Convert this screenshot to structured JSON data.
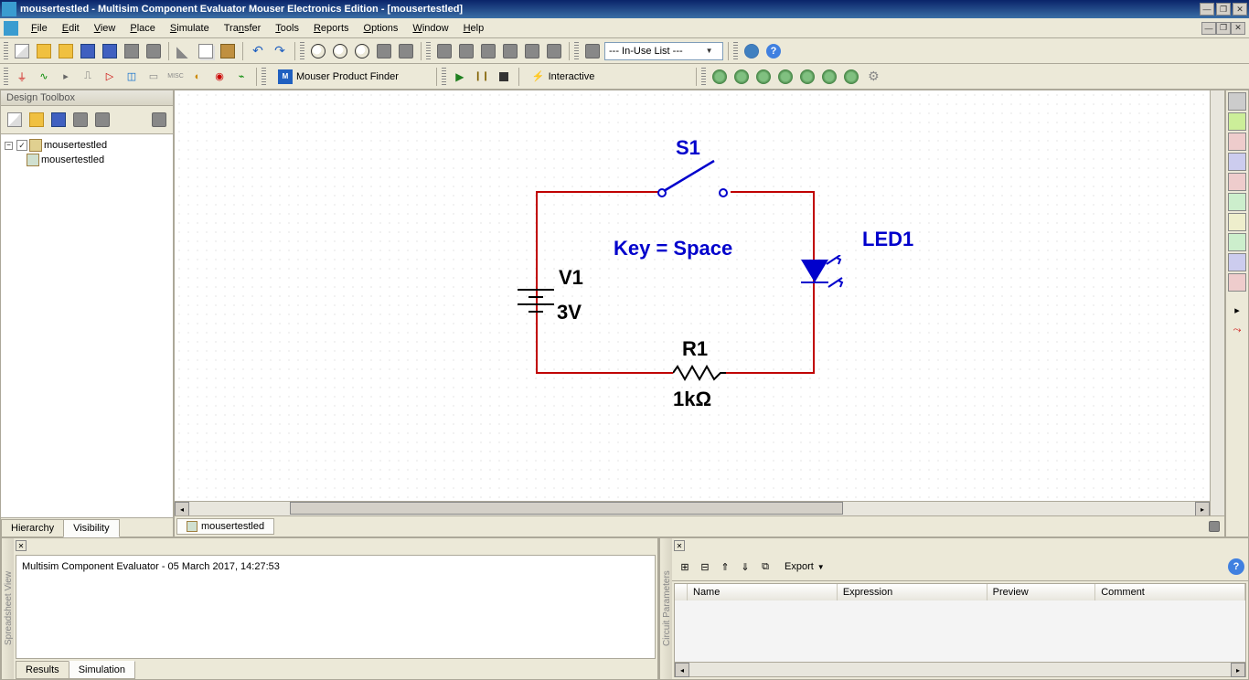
{
  "titlebar": {
    "title": "mousertestled - Multisim Component Evaluator Mouser Electronics Edition - [mousertestled]"
  },
  "menubar": {
    "items": [
      "File",
      "Edit",
      "View",
      "Place",
      "Simulate",
      "Transfer",
      "Tools",
      "Reports",
      "Options",
      "Window",
      "Help"
    ]
  },
  "toolbar2": {
    "product_finder": "Mouser Product Finder",
    "interactive": "Interactive",
    "in_use": "--- In-Use List ---"
  },
  "toolbox": {
    "title": "Design Toolbox",
    "root": "mousertestled",
    "child": "mousertestled",
    "tabs": [
      "Hierarchy",
      "Visibility"
    ]
  },
  "canvas": {
    "doc_tab": "mousertestled",
    "components": {
      "s1": "S1",
      "key": "Key = Space",
      "v1_name": "V1",
      "v1_val": "3V",
      "r1_name": "R1",
      "r1_val": "1kΩ",
      "led1": "LED1"
    }
  },
  "spreadsheet": {
    "side_label": "Spreadsheet View",
    "status": "Multisim Component Evaluator  -  05 March 2017, 14:27:53",
    "tabs": [
      "Results",
      "Simulation"
    ]
  },
  "circuit_params": {
    "side_label": "Circuit Parameters",
    "export": "Export",
    "columns": [
      "Name",
      "Expression",
      "Preview",
      "Comment"
    ]
  }
}
